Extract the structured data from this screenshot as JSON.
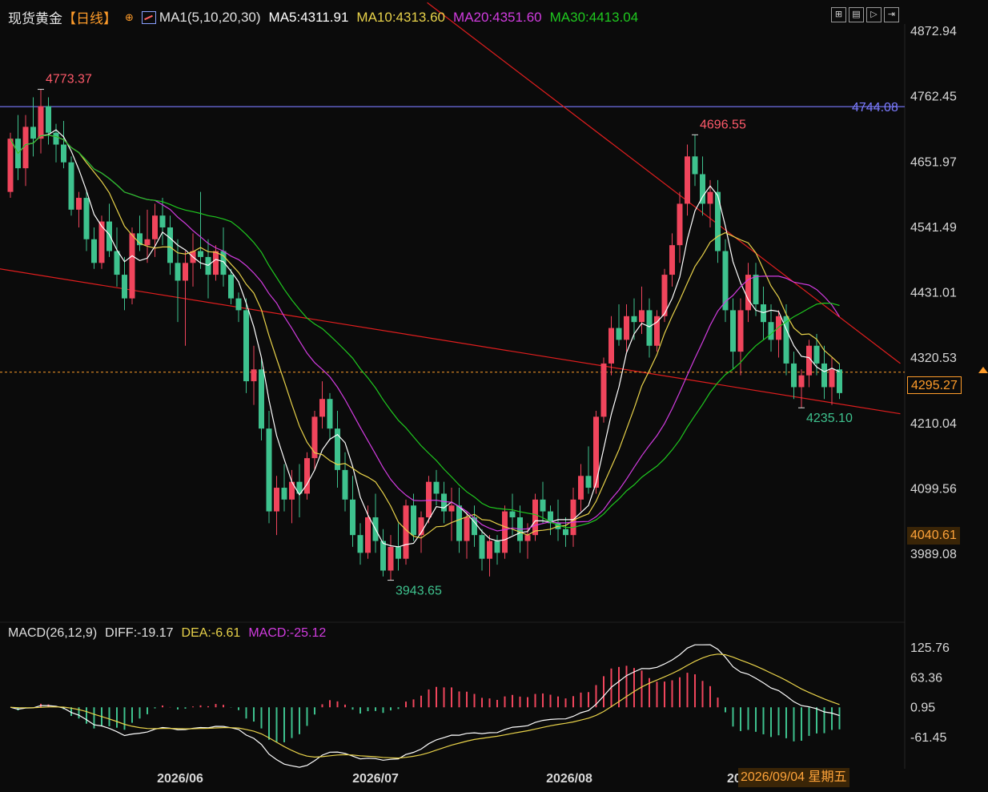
{
  "header": {
    "symbol": "现货黄金",
    "period": "【日线】",
    "target_icon": "crosshair-icon",
    "ma_label": "MA1(5,10,20,30)",
    "ma5": "MA5:4311.91",
    "ma10": "MA10:4313.60",
    "ma20": "MA20:4351.60",
    "ma30": "MA30:4413.04"
  },
  "toolbar": {
    "icons": [
      "fit-icon",
      "grid-icon",
      "play-icon",
      "step-icon"
    ]
  },
  "macd_header": {
    "label": "MACD(26,12,9)",
    "diff": "DIFF:-19.17",
    "dea": "DEA:-6.61",
    "macd": "MACD:-25.12"
  },
  "price_axis": [
    "4872.94",
    "4762.45",
    "4651.97",
    "4541.49",
    "4431.01",
    "4320.53",
    "4210.04",
    "4099.56",
    "3989.08"
  ],
  "macd_axis": [
    "125.76",
    "63.36",
    "0.95",
    "-61.45"
  ],
  "time_axis": [
    "2026/06",
    "2026/07",
    "2026/08",
    "20"
  ],
  "annotations": {
    "high": "4773.37",
    "peak2": "4696.55",
    "low": "3943.65",
    "recent_low": "4235.10",
    "hline": "4744.08"
  },
  "current_price": "4295.27",
  "crosshair_price": "4040.61",
  "crosshair_date": "2026/09/04 星期五",
  "colors": {
    "up": "#f0455c",
    "down": "#3ec28e",
    "ma5": "#ffffff",
    "ma10": "#e8d24a",
    "ma20": "#d23ce0",
    "ma30": "#1fc81f",
    "trend": "#e01e1e",
    "hline": "#7b7bff",
    "dea": "#e8d24a",
    "diff": "#ffffff"
  },
  "chart_data": [
    {
      "type": "candlestick",
      "title": "现货黄金 日线",
      "ylim": [
        3943.65,
        4872.94
      ],
      "price_ticks": [
        4872.94,
        4762.45,
        4651.97,
        4541.49,
        4431.01,
        4320.53,
        4210.04,
        4099.56,
        3989.08
      ],
      "extremes": {
        "high": 4773.37,
        "peak2": 4696.55,
        "low": 3943.65,
        "recent_low": 4235.1
      },
      "horizontal_line": 4744.08,
      "current_price": 4295.27,
      "ma": {
        "MA5": 4311.91,
        "MA10": 4313.6,
        "MA20": 4351.6,
        "MA30": 4413.04
      },
      "ohlc": [
        [
          4600,
          4700,
          4590,
          4690
        ],
        [
          4690,
          4730,
          4620,
          4640
        ],
        [
          4640,
          4730,
          4610,
          4710
        ],
        [
          4710,
          4760,
          4660,
          4690
        ],
        [
          4690,
          4773.37,
          4665,
          4745
        ],
        [
          4745,
          4760,
          4680,
          4700
        ],
        [
          4700,
          4715,
          4650,
          4680
        ],
        [
          4680,
          4720,
          4640,
          4650
        ],
        [
          4650,
          4660,
          4560,
          4570
        ],
        [
          4570,
          4600,
          4540,
          4590
        ],
        [
          4590,
          4600,
          4500,
          4520
        ],
        [
          4520,
          4540,
          4470,
          4480
        ],
        [
          4480,
          4560,
          4470,
          4550
        ],
        [
          4550,
          4580,
          4490,
          4500
        ],
        [
          4500,
          4540,
          4440,
          4460
        ],
        [
          4460,
          4490,
          4400,
          4420
        ],
        [
          4420,
          4540,
          4410,
          4530
        ],
        [
          4530,
          4560,
          4500,
          4510
        ],
        [
          4510,
          4570,
          4480,
          4520
        ],
        [
          4520,
          4580,
          4490,
          4560
        ],
        [
          4560,
          4590,
          4510,
          4540
        ],
        [
          4540,
          4560,
          4460,
          4480
        ],
        [
          4480,
          4520,
          4380,
          4450
        ],
        [
          4450,
          4500,
          4340,
          4480
        ],
        [
          4480,
          4530,
          4440,
          4500
        ],
        [
          4500,
          4600,
          4470,
          4490
        ],
        [
          4490,
          4520,
          4420,
          4460
        ],
        [
          4460,
          4510,
          4450,
          4500
        ],
        [
          4500,
          4540,
          4440,
          4460
        ],
        [
          4460,
          4470,
          4410,
          4420
        ],
        [
          4420,
          4430,
          4380,
          4400
        ],
        [
          4400,
          4420,
          4260,
          4280
        ],
        [
          4280,
          4340,
          4240,
          4300
        ],
        [
          4300,
          4320,
          4180,
          4200
        ],
        [
          4200,
          4230,
          4040,
          4060
        ],
        [
          4060,
          4120,
          4020,
          4100
        ],
        [
          4100,
          4140,
          4060,
          4080
        ],
        [
          4080,
          4130,
          4040,
          4110
        ],
        [
          4110,
          4140,
          4050,
          4090
        ],
        [
          4090,
          4160,
          4080,
          4150
        ],
        [
          4150,
          4230,
          4130,
          4220
        ],
        [
          4220,
          4280,
          4200,
          4250
        ],
        [
          4250,
          4260,
          4180,
          4200
        ],
        [
          4200,
          4230,
          4100,
          4130
        ],
        [
          4130,
          4160,
          4060,
          4080
        ],
        [
          4080,
          4120,
          4000,
          4020
        ],
        [
          4020,
          4040,
          3970,
          3990
        ],
        [
          3990,
          4070,
          3980,
          4050
        ],
        [
          4050,
          4090,
          3990,
          4010
        ],
        [
          4010,
          4030,
          3950,
          3960
        ],
        [
          3960,
          4020,
          3943.65,
          4000
        ],
        [
          4000,
          4040,
          3960,
          3980
        ],
        [
          3980,
          4080,
          3970,
          4070
        ],
        [
          4070,
          4090,
          4010,
          4020
        ],
        [
          4020,
          4060,
          3990,
          4050
        ],
        [
          4050,
          4120,
          4040,
          4110
        ],
        [
          4110,
          4130,
          4070,
          4090
        ],
        [
          4090,
          4110,
          4040,
          4060
        ],
        [
          4060,
          4100,
          4010,
          4070
        ],
        [
          4070,
          4100,
          3990,
          4010
        ],
        [
          4010,
          4060,
          3980,
          4050
        ],
        [
          4050,
          4070,
          4000,
          4020
        ],
        [
          4020,
          4030,
          3960,
          3980
        ],
        [
          3980,
          4020,
          3950,
          4010
        ],
        [
          4010,
          4020,
          3970,
          3990
        ],
        [
          3990,
          4070,
          3980,
          4060
        ],
        [
          4060,
          4090,
          4020,
          4050
        ],
        [
          4050,
          4070,
          3990,
          4010
        ],
        [
          4010,
          4040,
          3980,
          4020
        ],
        [
          4020,
          4090,
          4010,
          4080
        ],
        [
          4080,
          4110,
          4040,
          4060
        ],
        [
          4060,
          4070,
          4020,
          4040
        ],
        [
          4040,
          4080,
          4010,
          4030
        ],
        [
          4030,
          4050,
          4000,
          4020
        ],
        [
          4020,
          4100,
          4000,
          4080
        ],
        [
          4080,
          4140,
          4060,
          4120
        ],
        [
          4120,
          4170,
          4090,
          4100
        ],
        [
          4100,
          4230,
          4090,
          4220
        ],
        [
          4220,
          4320,
          4210,
          4310
        ],
        [
          4310,
          4390,
          4290,
          4370
        ],
        [
          4370,
          4410,
          4340,
          4350
        ],
        [
          4350,
          4410,
          4330,
          4390
        ],
        [
          4390,
          4420,
          4350,
          4380
        ],
        [
          4380,
          4440,
          4360,
          4400
        ],
        [
          4400,
          4420,
          4320,
          4340
        ],
        [
          4340,
          4400,
          4330,
          4390
        ],
        [
          4390,
          4470,
          4380,
          4460
        ],
        [
          4460,
          4530,
          4440,
          4510
        ],
        [
          4510,
          4600,
          4480,
          4580
        ],
        [
          4580,
          4680,
          4560,
          4660
        ],
        [
          4660,
          4696.55,
          4610,
          4630
        ],
        [
          4630,
          4660,
          4560,
          4580
        ],
        [
          4580,
          4620,
          4540,
          4600
        ],
        [
          4600,
          4620,
          4480,
          4500
        ],
        [
          4500,
          4520,
          4380,
          4400
        ],
        [
          4400,
          4420,
          4300,
          4330
        ],
        [
          4330,
          4420,
          4290,
          4400
        ],
        [
          4400,
          4480,
          4380,
          4460
        ],
        [
          4460,
          4480,
          4390,
          4410
        ],
        [
          4410,
          4440,
          4350,
          4380
        ],
        [
          4380,
          4410,
          4330,
          4350
        ],
        [
          4350,
          4400,
          4320,
          4390
        ],
        [
          4390,
          4410,
          4290,
          4310
        ],
        [
          4310,
          4330,
          4250,
          4270
        ],
        [
          4270,
          4300,
          4235.1,
          4290
        ],
        [
          4290,
          4350,
          4270,
          4340
        ],
        [
          4340,
          4360,
          4290,
          4310
        ],
        [
          4310,
          4340,
          4250,
          4270
        ],
        [
          4270,
          4320,
          4240,
          4300
        ],
        [
          4300,
          4310,
          4250,
          4260
        ]
      ]
    },
    {
      "type": "bar",
      "title": "MACD(26,12,9)",
      "ylim": [
        -61.45,
        125.76
      ],
      "values": {
        "DIFF": -19.17,
        "DEA": -6.61,
        "MACD": -25.12
      },
      "ticks": [
        125.76,
        63.36,
        0.95,
        -61.45
      ]
    }
  ]
}
